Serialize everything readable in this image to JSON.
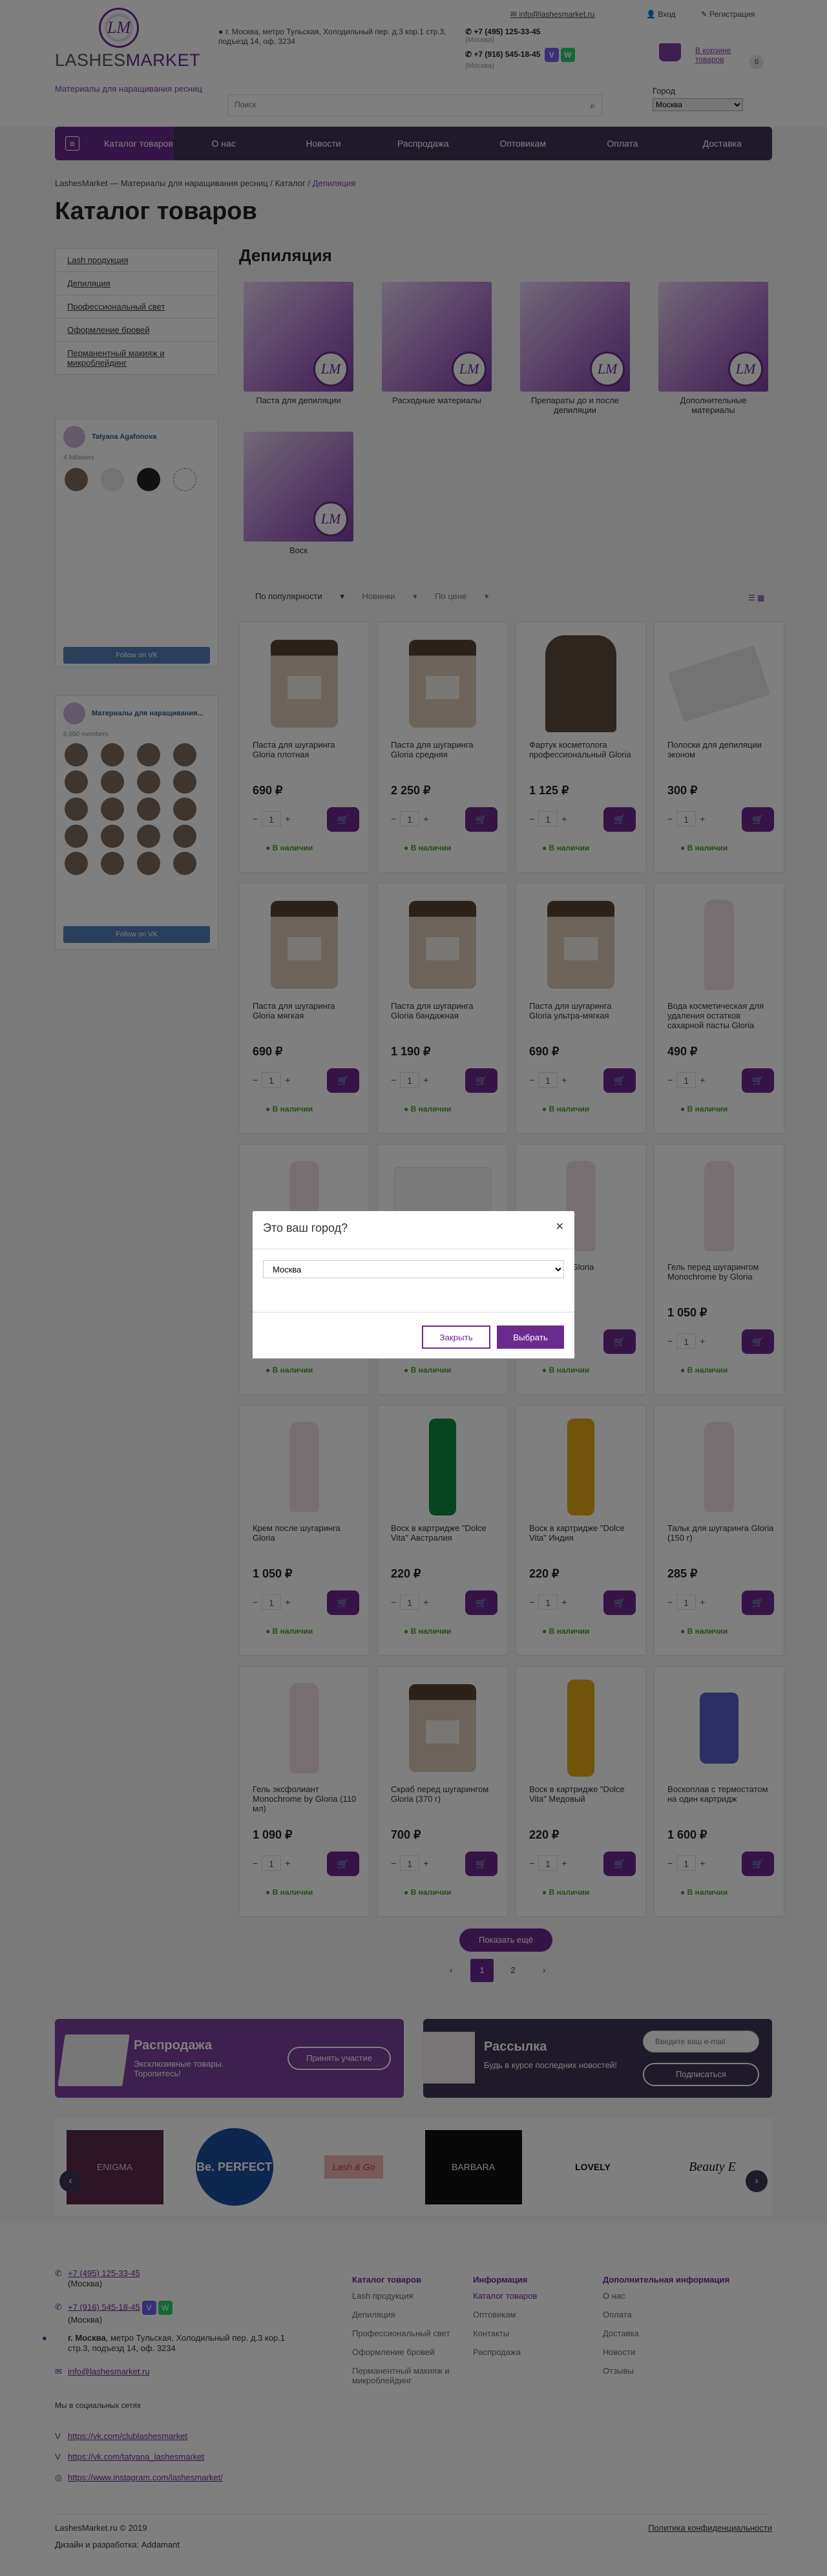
{
  "header": {
    "logo_text_light": "LASHES",
    "logo_text_bold": "MARKET",
    "tagline": "Материалы для наращивания ресниц",
    "address": "г. Москва, метро Тульская, Холодильный пер. д.3 кор.1 стр.3, подъезд 14, оф. 3234",
    "phone1": "+7 (495) 125-33-45",
    "phone1_sub": "(Москва)",
    "phone2": "+7 (916) 545-18-45",
    "phone2_sub": "(Москва)",
    "email": "info@lashesmarket.ru",
    "login": "Вход",
    "register": "Регистрация",
    "cart_label": "В корзине товаров",
    "cart_count": "0",
    "search_placeholder": "Поиск",
    "city_label": "Город",
    "city_value": "Москва"
  },
  "nav": {
    "catalog": "Каталог товаров",
    "items": [
      "О нас",
      "Новости",
      "Распродажа",
      "Оптовикам",
      "Оплата",
      "Доставка"
    ]
  },
  "breadcrumbs": [
    "LashesMarket — Материалы для наращивания ресниц",
    "Каталог",
    "Депиляция"
  ],
  "page_title": "Каталог товаров",
  "sidebar": {
    "menu": [
      "Lash продукция",
      "Депиляция",
      "Профессиональный свет",
      "Оформление бровей",
      "Перманентный макияж и микроблейдинг"
    ],
    "vk1": {
      "name": "Tatyana Agafonova",
      "sub": "4 followers",
      "btn": "Follow on VK"
    },
    "vk2": {
      "name": "Материалы для наращивания...",
      "sub": "6,050 members",
      "btn": "Follow on VK"
    }
  },
  "section_title": "Депиляция",
  "categories": [
    "Паста для депиляции",
    "Расходные материалы",
    "Препараты до и после депиляции",
    "Дополнительные материалы",
    "Воск"
  ],
  "sort": {
    "popular": "По популярности",
    "new": "Новинки",
    "price": "По цене"
  },
  "products": [
    {
      "name": "Паста для шугаринга Gloria плотная",
      "price": "690 ₽"
    },
    {
      "name": "Паста для шугаринга Gloria средняя",
      "price": "2 250 ₽"
    },
    {
      "name": "Фартук косметолога профессиональный Gloria",
      "price": "1 125 ₽"
    },
    {
      "name": "Полоски для депиляции эконом",
      "price": "300 ₽"
    },
    {
      "name": "Паста для шугаринга Gloria мягкая",
      "price": "690 ₽"
    },
    {
      "name": "Паста для шугаринга Gloria бандажная",
      "price": "1 190 ₽"
    },
    {
      "name": "Паста для шугаринга Gloria ультра-мягкая",
      "price": "690 ₽"
    },
    {
      "name": "Вода косметическая для удаления остатков сахарной пасты Gloria",
      "price": "490 ₽"
    },
    {
      "name": "",
      "price": ""
    },
    {
      "name": "",
      "price": ""
    },
    {
      "name": "шугаринга Gloria",
      "price": ""
    },
    {
      "name": "Гель перед шугарингом Monochrome by Gloria",
      "price": "1 050 ₽"
    },
    {
      "name": "Крем после шугаринга Gloria",
      "price": "1 050 ₽"
    },
    {
      "name": "Воск в картридже \"Dolce Vita\" Австралия",
      "price": "220 ₽"
    },
    {
      "name": "Воск в картридже \"Dolce Vita\" Индия",
      "price": "220 ₽"
    },
    {
      "name": "Тальк для шугаринга Gloria (150 г)",
      "price": "285 ₽"
    },
    {
      "name": "Гель эксфолиант Monochrome by Gloria (110 мл)",
      "price": "1 090 ₽"
    },
    {
      "name": "Скраб перед шугарингом Gloria (370 г)",
      "price": "700 ₽"
    },
    {
      "name": "Воск в картридже \"Dolce Vita\" Медовый",
      "price": "220 ₽"
    },
    {
      "name": "Воскоплав с термостатом на один картридж",
      "price": "1 600 ₽"
    }
  ],
  "qty_value": "1",
  "in_stock": "В наличии",
  "show_more": "Показать ещё",
  "pages": [
    "1",
    "2"
  ],
  "promo_sale": {
    "title": "Распродажа",
    "text": "Эксклюзивные товары. Торопитесь!",
    "btn": "Принять участие"
  },
  "promo_news": {
    "title": "Рассылка",
    "text": "Будь в курсе последних новостей!",
    "placeholder": "Введите ваш e-mail",
    "btn": "Подписаться"
  },
  "brands": [
    "ENIGMA",
    "Be. PERFECT",
    "Lash & Go",
    "BARBARA",
    "LOVELY",
    "Beauty E"
  ],
  "modal": {
    "title": "Это ваш город?",
    "value": "Москва",
    "close": "Закрыть",
    "choose": "Выбрать"
  },
  "footer": {
    "phone1": "+7 (495) 125-33-45",
    "phone1_sub": "(Москва)",
    "phone2": "+7 (916) 545-18-45",
    "phone2_sub": "(Москва)",
    "address_bold": "г. Москва",
    "address": ", метро Тульская, Холодильный пер. д.3 кор.1 стр.3, подъезд 14, оф. 3234",
    "email": "info@lashesmarket.ru",
    "social_title": "Мы в социальных сетях",
    "social": [
      "https://vk.com/clublashesmarket",
      "https://vk.com/tatyana_lashesmarket",
      "https://www.instagram.com/lashesmarket/"
    ],
    "col1_title": "Каталог товаров",
    "col1": [
      "Lash продукция",
      "Депиляция",
      "Профессиональный свет",
      "Оформление бровей",
      "Перманентный макияж и микроблейдинг"
    ],
    "col2_title": "Информация",
    "col2": [
      "Каталог товаров",
      "Оптовикам",
      "Контакты",
      "Распродажа"
    ],
    "col3_title": "Дополнительная информация",
    "col3": [
      "О нас",
      "Оплата",
      "Доставка",
      "Новости",
      "Отзывы"
    ],
    "copyright": "LashesMarket.ru © 2019",
    "dev": "Дизайн и разработка: Addamant",
    "policy": "Политика конфиденциальности"
  },
  "colors": {
    "brand": "#6a2b8f",
    "nav": "#3f3554",
    "stock": "#4a9a2f"
  }
}
